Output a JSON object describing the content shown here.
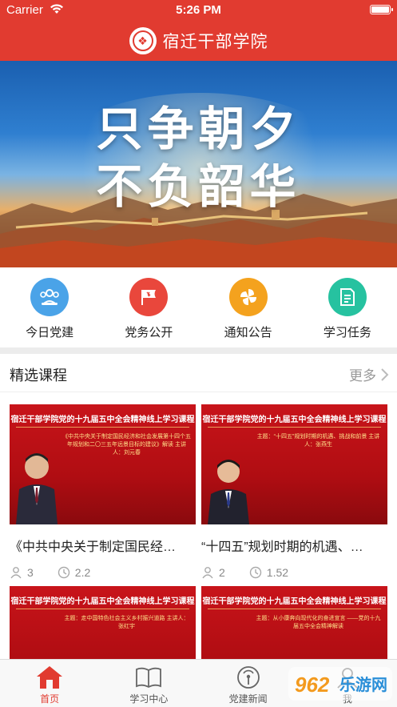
{
  "status_bar": {
    "carrier": "Carrier",
    "time": "5:26 PM"
  },
  "header": {
    "title": "宿迁干部学院"
  },
  "banner": {
    "line1": "只争朝夕",
    "line2": "不负韶华"
  },
  "quick_nav": [
    {
      "label": "今日党建",
      "icon": "people-icon",
      "color": "#4aa3e8"
    },
    {
      "label": "党务公开",
      "icon": "party-flag-icon",
      "color": "#e9473c"
    },
    {
      "label": "通知公告",
      "icon": "pinwheel-icon",
      "color": "#f4a21e"
    },
    {
      "label": "学习任务",
      "icon": "document-icon",
      "color": "#26c2a0"
    }
  ],
  "section": {
    "title": "精选课程",
    "more": "更多"
  },
  "courses": [
    {
      "thumb_header": "宿迁干部学院党的十九届五中全会精神线上学习课程",
      "thumb_text": "《中共中央关于制定国民经济和社会发展第十四个五年规划和二〇三五年远景目标的建议》解读 主讲人：刘元春",
      "title": "《中共中央关于制定国民经…",
      "learners": "3",
      "hours": "2.2"
    },
    {
      "thumb_header": "宿迁干部学院党的十九届五中全会精神线上学习课程",
      "thumb_text": "主题：“十四五”规划时期的机遇、挑战和前景 主讲人：张燕生",
      "title": "“十四五”规划时期的机遇、…",
      "learners": "2",
      "hours": "1.52"
    },
    {
      "thumb_header": "宿迁干部学院党的十九届五中全会精神线上学习课程",
      "thumb_text": "主题：走中国特色社会主义乡村振兴道路 主讲人：张红宇"
    },
    {
      "thumb_header": "宿迁干部学院党的十九届五中全会精神线上学习课程",
      "thumb_text": "主题：从小康奔向现代化的奋进宣言 ——党的十九届五中全会精神解读"
    }
  ],
  "tabs": [
    {
      "label": "首页",
      "icon": "home-icon",
      "active": true
    },
    {
      "label": "学习中心",
      "icon": "book-icon",
      "active": false
    },
    {
      "label": "党建新闻",
      "icon": "broadcast-icon",
      "active": false
    },
    {
      "label": "我",
      "icon": "person-icon",
      "active": false
    }
  ],
  "watermark": {
    "text": "962乐游网"
  },
  "colors": {
    "primary": "#e13b30",
    "thumb_red": "#c8141a"
  }
}
